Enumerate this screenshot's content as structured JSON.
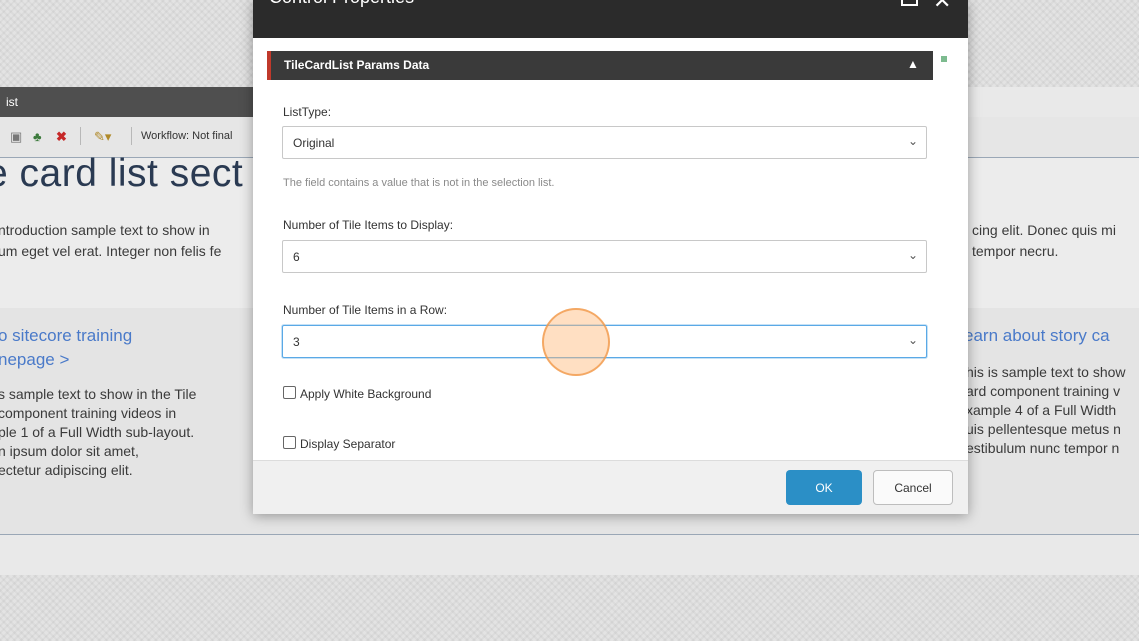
{
  "ribbon": {
    "title": "ist"
  },
  "toolbar": {
    "workflow_label": "Workflow: Not final"
  },
  "page": {
    "section_title": "e card list sect",
    "intro_left": [
      "ntroduction sample text to show in",
      "um eget vel erat. Integer non felis fe"
    ],
    "intro_right": [
      "cing elit. Donec quis mi",
      "tempor necru."
    ],
    "card_left": {
      "link": [
        "o sitecore training",
        "nepage >"
      ],
      "text": [
        "s sample text to show in the Tile",
        "component training videos in",
        "ple 1 of a Full Width sub-layout.",
        "n ipsum dolor sit amet,",
        "ectetur adipiscing elit."
      ]
    },
    "card_right": {
      "link": [
        "earn about story ca"
      ],
      "text": [
        "his is sample text to show",
        "ard component training v",
        "xample 4 of a Full Width",
        "uis pellentesque metus n",
        "estibulum nunc tempor n"
      ]
    }
  },
  "dialog": {
    "title": "Control Properties",
    "section_title": "TileCardList Params Data",
    "list_type": {
      "label": "ListType:",
      "value": "Original",
      "note": "The field contains a value that is not in the selection list."
    },
    "items_to_display": {
      "label": "Number of Tile Items to Display:",
      "value": "6"
    },
    "items_in_row": {
      "label": "Number of Tile Items in a Row:",
      "value": "3"
    },
    "white_background": {
      "label": "Apply White Background",
      "checked": false
    },
    "separator": {
      "label": "Display Separator",
      "checked": false
    },
    "ok_label": "OK",
    "cancel_label": "Cancel"
  },
  "colors": {
    "accent_blue": "#2b8fc6",
    "link_blue": "#4a7ac9",
    "header_dark": "#2b2b2b",
    "section_red": "#c0392b"
  }
}
